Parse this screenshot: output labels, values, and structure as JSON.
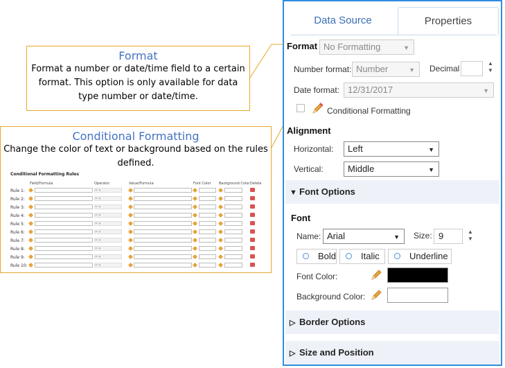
{
  "callouts": {
    "format": {
      "title": "Format",
      "body": "Format a number or date/time field to a certain format.  This option is only available for data type number or date/time."
    },
    "conditional": {
      "title": "Conditional Formatting",
      "body": "Change the color of text or background based on the rules defined."
    }
  },
  "rules_table": {
    "title": "Conditional Formatting Rules",
    "headers": {
      "field": "Field/Formula",
      "operator": "Operator",
      "value": "Value/Formula",
      "font_color": "Font Color",
      "background_color": "Background Color",
      "delete": "Delete"
    },
    "operator_placeholder": "=",
    "rules": [
      "Rule 1:",
      "Rule 2:",
      "Rule 3:",
      "Rule 4:",
      "Rule 5:",
      "Rule 6:",
      "Rule 7:",
      "Rule 8:",
      "Rule 9:",
      "Rule 10:"
    ]
  },
  "tabs": {
    "data_source": "Data Source",
    "properties": "Properties"
  },
  "format": {
    "label": "Format",
    "value": "No Formatting",
    "number_format_label": "Number format:",
    "number_format_value": "Number",
    "decimal_label": "Decimal",
    "decimal_value": "",
    "date_format_label": "Date format:",
    "date_format_value": "12/31/2017",
    "conditional_label": "Conditional Formatting",
    "conditional_checked": false
  },
  "alignment": {
    "label": "Alignment",
    "horizontal_label": "Horizontal:",
    "horizontal_value": "Left",
    "vertical_label": "Vertical:",
    "vertical_value": "Middle"
  },
  "font_options": {
    "label": "Font Options",
    "expanded": true,
    "font_label": "Font",
    "name_label": "Name:",
    "name_value": "Arial",
    "size_label": "Size:",
    "size_value": "9",
    "bold_label": "Bold",
    "italic_label": "Italic",
    "underline_label": "Underline",
    "font_color_label": "Font Color:",
    "font_color_value": "#000000",
    "background_color_label": "Background Color:",
    "background_color_value": "#ffffff"
  },
  "border_options": {
    "label": "Border Options",
    "expanded": false
  },
  "size_position": {
    "label": "Size and Position",
    "expanded": false
  },
  "colors": {
    "accent": "#2f8ce0",
    "callout_border": "#e5a82a",
    "callout_title": "#4472c4",
    "section_bg": "#eef2f8"
  }
}
